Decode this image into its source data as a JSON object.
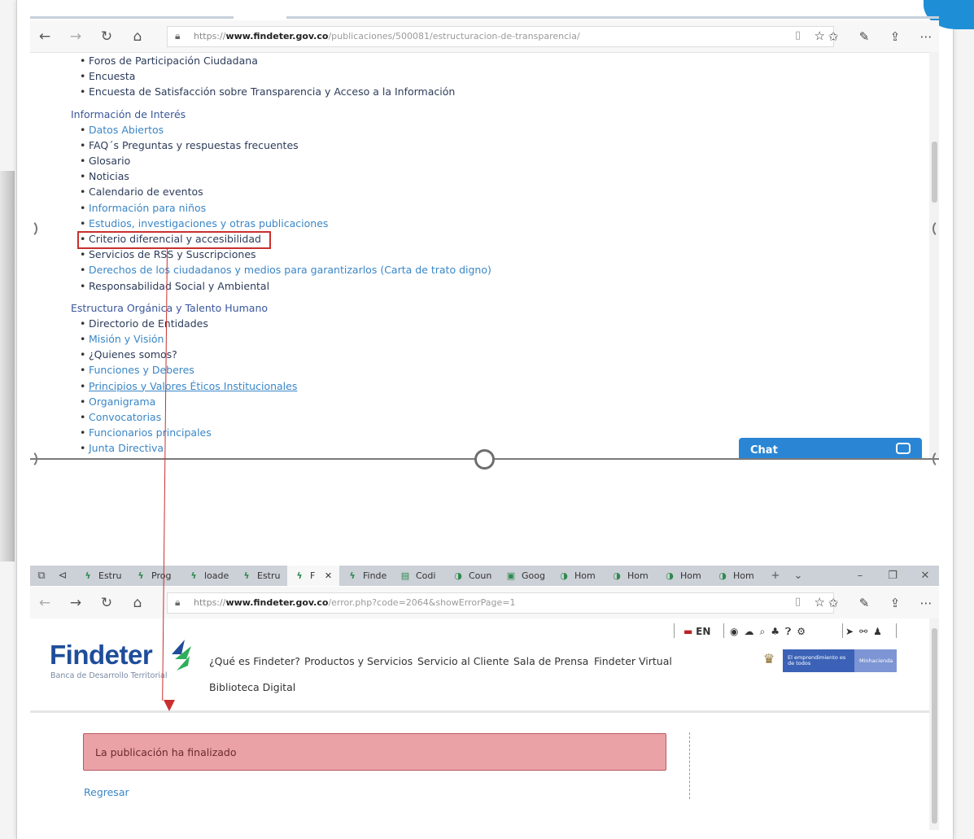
{
  "top_browser": {
    "url_prefix": "https://",
    "url_domain": "www.findeter.gov.co",
    "url_path": "/publicaciones/500081/estructuracion-de-transparencia/"
  },
  "list": {
    "group1_items": [
      {
        "label": "Foros de Participación Ciudadana",
        "style": "dark"
      },
      {
        "label": "Encuesta",
        "style": "dark"
      },
      {
        "label": "Encuesta de Satisfacción sobre Transparencia y Acceso a la Información",
        "style": "dark"
      }
    ],
    "section2_title": "Información de Interés",
    "section2_items": [
      {
        "label": "Datos Abiertos",
        "style": "link"
      },
      {
        "label": "FAQ´s Preguntas y respuestas frecuentes",
        "style": "dark"
      },
      {
        "label": "Glosario",
        "style": "dark"
      },
      {
        "label": "Noticias",
        "style": "dark"
      },
      {
        "label": "Calendario de eventos",
        "style": "dark"
      },
      {
        "label": "Información para niños",
        "style": "link"
      },
      {
        "label": "Estudios, investigaciones y otras publicaciones",
        "style": "link"
      },
      {
        "label": "Criterio diferencial y accesibilidad",
        "style": "dark"
      },
      {
        "label": "Servicios de RSS y Suscripciones",
        "style": "dark"
      },
      {
        "label": "Derechos de los ciudadanos y medios para garantizarlos (Carta de trato digno)",
        "style": "link"
      },
      {
        "label": "Responsabilidad Social y Ambiental",
        "style": "dark"
      }
    ],
    "section3_title": "Estructura Orgánica y Talento Humano",
    "section3_items": [
      {
        "label": "Directorio de Entidades",
        "style": "dark"
      },
      {
        "label": "Misión y Visión",
        "style": "link"
      },
      {
        "label": "¿Quienes somos?",
        "style": "dark"
      },
      {
        "label": "Funciones y Deberes",
        "style": "link"
      },
      {
        "label": "Principios y Valores Éticos Institucionales",
        "style": "link under"
      },
      {
        "label": "Organigrama",
        "style": "link"
      },
      {
        "label": "Convocatorias",
        "style": "link"
      },
      {
        "label": "Funcionarios principales",
        "style": "link"
      },
      {
        "label": "Junta Directiva",
        "style": "link"
      }
    ]
  },
  "chat": {
    "label": "Chat"
  },
  "tabs": [
    "Estru",
    "Prog",
    "loade",
    "Estru",
    "F",
    "Finde",
    "Codi",
    "Coun",
    "Goog",
    "Hom",
    "Hom",
    "Hom",
    "Hom"
  ],
  "bottom_browser": {
    "url_prefix": "https://",
    "url_domain": "www.findeter.gov.co",
    "url_path": "/error.php?code=2064&showErrorPage=1"
  },
  "site": {
    "logo": "Findeter",
    "logo_sub": "Banca de Desarrollo Territorial",
    "lang": "EN",
    "nav": [
      "¿Qué es Findeter?",
      "Productos y Servicios",
      "Servicio al Cliente",
      "Sala de Prensa",
      "Findeter Virtual",
      "Biblioteca Digital"
    ],
    "gov_band_1": "El emprendimiento es de todos",
    "gov_band_2": "Minhacienda",
    "alert": "La publicación ha finalizado",
    "back": "Regresar"
  },
  "colors": {
    "accent": "#2a86d4",
    "alert_bg": "#eaa2a7",
    "highlight": "#c8302f",
    "link": "#3a86c6"
  }
}
